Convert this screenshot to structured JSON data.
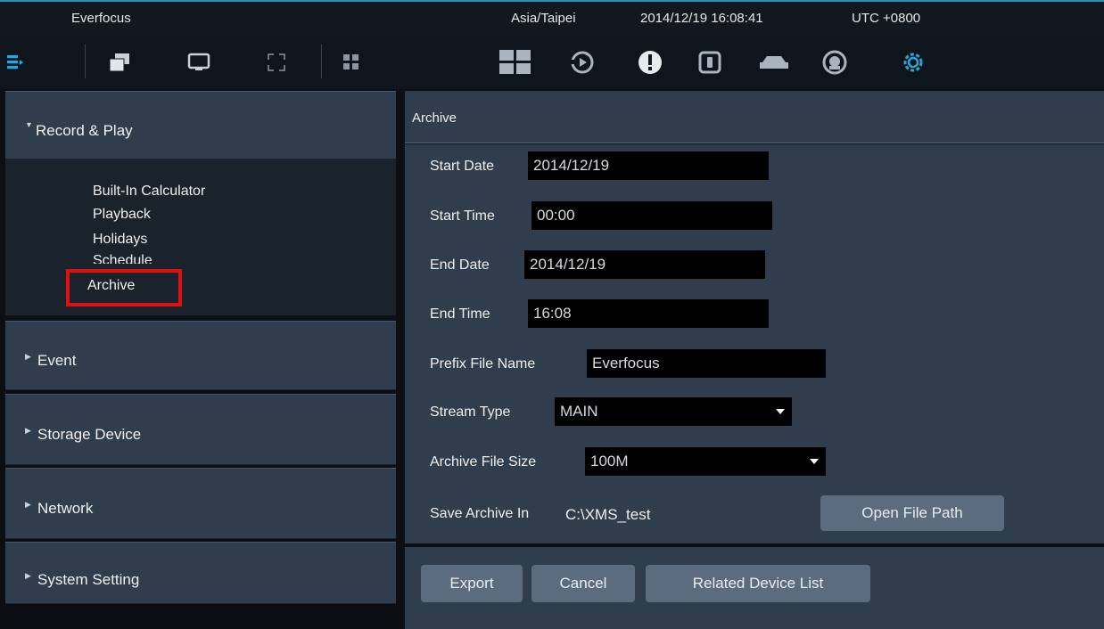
{
  "titlebar": {
    "app_name": "Everfocus",
    "timezone": "Asia/Taipei",
    "datetime": "2014/12/19 16:08:41",
    "utc_offset": "UTC +0800"
  },
  "toolbar": {
    "left_icons": [
      "menu-list-icon",
      "windows-stack-icon",
      "monitor-icon",
      "fullscreen-icon",
      "grid-split-icon"
    ],
    "right_icons": [
      "layout-grid-icon",
      "playback-icon",
      "alert-icon",
      "lock-icon",
      "car-icon",
      "face-recognition-icon",
      "settings-gear-icon"
    ],
    "accent": "#29a8d8"
  },
  "sidebar": {
    "sections": [
      {
        "label": "Record & Play",
        "expanded": true
      },
      {
        "label": "Event",
        "expanded": false
      },
      {
        "label": "Storage Device",
        "expanded": false
      },
      {
        "label": "Network",
        "expanded": false
      },
      {
        "label": "System Setting",
        "expanded": false
      }
    ],
    "subitems": [
      "Built-In Calculator",
      "Playback",
      "Holidays",
      "Schedule",
      "Archive"
    ],
    "selected": "Archive"
  },
  "main": {
    "title": "Archive",
    "fields": {
      "start_date": {
        "label": "Start Date",
        "value": "2014/12/19"
      },
      "start_time": {
        "label": "Start Time",
        "value": "00:00"
      },
      "end_date": {
        "label": "End Date",
        "value": "2014/12/19"
      },
      "end_time": {
        "label": "End Time",
        "value": "16:08"
      },
      "prefix": {
        "label": "Prefix File Name",
        "value": "Everfocus"
      },
      "stream_type": {
        "label": "Stream Type",
        "value": "MAIN"
      },
      "file_size": {
        "label": "Archive File Size",
        "value": "100M"
      },
      "save_in": {
        "label": "Save Archive In",
        "value": "C:\\XMS_test"
      }
    },
    "open_path_label": "Open File Path",
    "buttons": {
      "export": "Export",
      "cancel": "Cancel",
      "related": "Related Device List"
    }
  }
}
